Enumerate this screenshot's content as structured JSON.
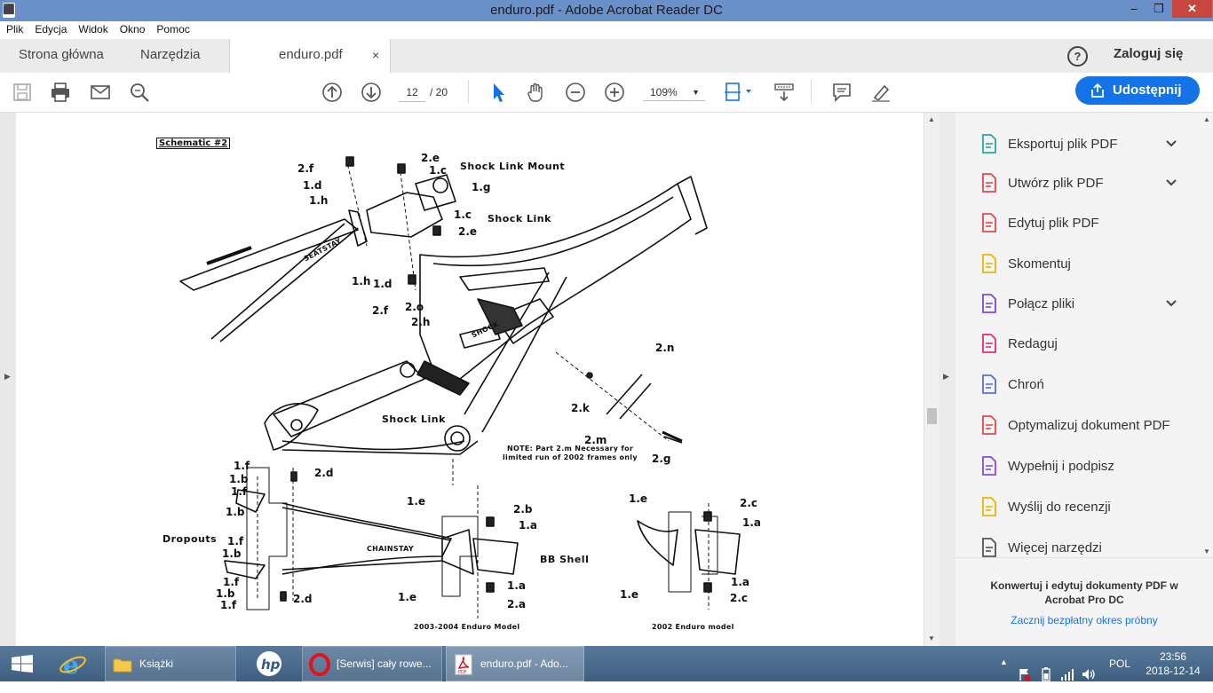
{
  "window": {
    "title": "enduro.pdf - Adobe Acrobat Reader DC",
    "minimize": "–",
    "restore": "❐",
    "close": "✕"
  },
  "menu": [
    "Plik",
    "Edycja",
    "Widok",
    "Okno",
    "Pomoc"
  ],
  "tabs": {
    "home": "Strona główna",
    "tools": "Narzędzia",
    "document": "enduro.pdf",
    "document_close": "×"
  },
  "header": {
    "help": "?",
    "login": "Zaloguj się"
  },
  "toolbar": {
    "current_page": "12",
    "total_pages": "/ 20",
    "zoom": "109%",
    "share_label": "Udostępnij"
  },
  "tools_panel": {
    "items": [
      {
        "label": "Eksportuj plik PDF",
        "icon": "export-pdf-icon",
        "color": "#27a99b",
        "chevron": true
      },
      {
        "label": "Utwórz plik PDF",
        "icon": "create-pdf-icon",
        "color": "#e34850",
        "chevron": true
      },
      {
        "label": "Edytuj plik PDF",
        "icon": "edit-pdf-icon",
        "color": "#e34850",
        "chevron": false
      },
      {
        "label": "Skomentuj",
        "icon": "comment-icon",
        "color": "#e8b800",
        "chevron": false
      },
      {
        "label": "Połącz pliki",
        "icon": "combine-files-icon",
        "color": "#7b4bd6",
        "chevron": true
      },
      {
        "label": "Redaguj",
        "icon": "redact-icon",
        "color": "#e0307a",
        "chevron": false
      },
      {
        "label": "Chroń",
        "icon": "protect-shield-icon",
        "color": "#5a6fd6",
        "chevron": false
      },
      {
        "label": "Optymalizuj dokument PDF",
        "icon": "optimize-pdf-icon",
        "color": "#e34850",
        "chevron": false
      },
      {
        "label": "Wypełnij i podpisz",
        "icon": "fill-sign-icon",
        "color": "#8a4bd6",
        "chevron": false
      },
      {
        "label": "Wyślij do recenzji",
        "icon": "send-review-icon",
        "color": "#e8b800",
        "chevron": false
      },
      {
        "label": "Więcej narzędzi",
        "icon": "more-tools-icon",
        "color": "#555555",
        "chevron": false
      }
    ],
    "promo": "Konwertuj i edytuj dokumenty PDF w Acrobat Pro DC",
    "trial_link": "Zacznij bezpłatny okres próbny"
  },
  "schematic": {
    "title": "Schematic #2",
    "labels": {
      "shock_link_mount": "Shock Link Mount",
      "shock_link_top": "Shock Link",
      "shock_link_bottom": "Shock Link",
      "seatstay": "SEATSTAY",
      "shock": "SHOCK",
      "chainstay": "CHAINSTAY",
      "dropouts": "Dropouts",
      "bb_shell": "BB Shell",
      "note_line1": "NOTE: Part 2.m Necessary for",
      "note_line2": "limited run of 2002 frames only",
      "model_2003": "2003-2004 Enduro Model",
      "model_2002": "2002 Enduro model"
    },
    "parts": {
      "p_2f_a": "2.f",
      "p_1d_a": "1.d",
      "p_1h_a": "1.h",
      "p_2e_a": "2.e",
      "p_1c_a": "1.c",
      "p_1g": "1.g",
      "p_1c_b": "1.c",
      "p_2e_b": "2.e",
      "p_1h_b": "1.h",
      "p_1d_b": "1.d",
      "p_2f_b": "2.f",
      "p_2o": "2.o",
      "p_2h": "2.h",
      "p_2n": "2.n",
      "p_2k": "2.k",
      "p_2m": "2.m",
      "p_2g": "2.g",
      "p_1f_1": "1.f",
      "p_1b_1": "1.b",
      "p_1f_2": "1.f",
      "p_1b_2": "1.b",
      "p_1f_3": "1.f",
      "p_1b_3": "1.b",
      "p_1f_4": "1.f",
      "p_1b_4": "1.b",
      "p_1f_5": "1.f",
      "p_2d_a": "2.d",
      "p_2d_b": "2.d",
      "p_1e_a": "1.e",
      "p_1e_b": "1.e",
      "p_2b": "2.b",
      "p_1a_a": "1.a",
      "p_1a_b": "1.a",
      "p_2a": "2.a",
      "p_1e_c": "1.e",
      "p_1e_d": "1.e",
      "p_2c_a": "2.c",
      "p_1a_c": "1.a",
      "p_1a_d": "1.a",
      "p_2c_b": "2.c"
    }
  },
  "taskbar": {
    "apps": [
      {
        "label": "Książki",
        "icon": "folder-icon"
      },
      {
        "label": "[Serwis] cały rowe...",
        "icon": "opera-icon"
      },
      {
        "label": "enduro.pdf - Ado...",
        "icon": "acrobat-icon"
      }
    ],
    "language": "POL",
    "time": "23:56",
    "date": "2018-12-14"
  }
}
